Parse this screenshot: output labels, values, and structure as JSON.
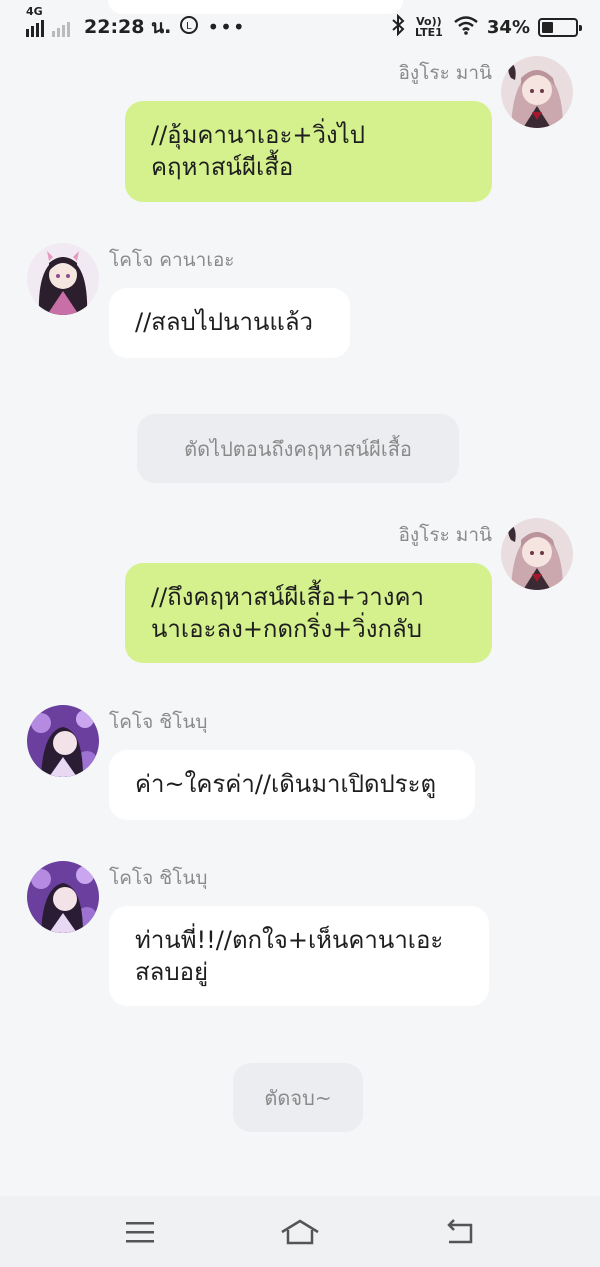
{
  "status_bar": {
    "network": "4G",
    "time": "22:28 น.",
    "volte": "Vo)) LTE1",
    "battery_percent": "34%",
    "battery_level": 0.34,
    "icons": [
      "signal-icon",
      "line-app-icon",
      "more-icon",
      "bluetooth-icon",
      "wifi-icon",
      "battery-icon"
    ]
  },
  "messages": [
    {
      "type": "out",
      "sender": "อิงูโระ มานิ",
      "lines": [
        "//อุ้มคานาเอะ+วิ่งไป",
        "คฤหาสน์ผีเสื้อ"
      ]
    },
    {
      "type": "in",
      "sender": "โคโจ คานาเอะ",
      "lines": [
        "//สลบไปนานแล้ว"
      ]
    },
    {
      "type": "system",
      "text": "ตัดไปตอนถึงคฤหาสน์ผีเสื้อ"
    },
    {
      "type": "out",
      "sender": "อิงูโระ มานิ",
      "lines": [
        "//ถึงคฤหาสน์ผีเสื้อ+วางคา",
        "นาเอะลง+กดกริ่ง+วิ่งกลับ"
      ]
    },
    {
      "type": "in",
      "sender": "โคโจ ชิโนบุ",
      "lines": [
        "ค่า~ใครค่า//เดินมาเปิดประตู"
      ]
    },
    {
      "type": "in",
      "sender": "โคโจ ชิโนบุ",
      "lines": [
        "ท่านพี่!!//ตกใจ+เห็นคานาเอะ",
        "สลบอยู่"
      ]
    },
    {
      "type": "system",
      "text": "ตัดจบ~"
    }
  ],
  "nav_bar": {
    "icons": [
      "menu-icon",
      "home-icon",
      "back-icon"
    ]
  },
  "colors": {
    "background": "#f5f6f8",
    "outgoing_bubble": "#d5f18e",
    "incoming_bubble": "#ffffff",
    "system_bubble": "#ebedf0",
    "name_text": "#8a8a8a"
  }
}
